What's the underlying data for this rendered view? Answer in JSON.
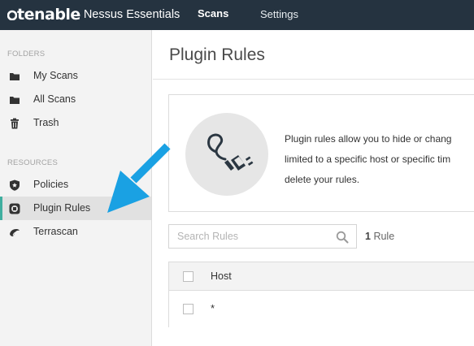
{
  "topbar": {
    "logo_text": "tenable",
    "product": "Nessus Essentials",
    "nav": [
      {
        "label": "Scans",
        "active": true
      },
      {
        "label": "Settings",
        "active": false
      }
    ],
    "background": "#253340"
  },
  "sidebar": {
    "folders_label": "FOLDERS",
    "folders": [
      {
        "label": "My Scans",
        "icon": "folder-icon"
      },
      {
        "label": "All Scans",
        "icon": "folder-icon"
      },
      {
        "label": "Trash",
        "icon": "trash-icon"
      }
    ],
    "resources_label": "RESOURCES",
    "resources": [
      {
        "label": "Policies",
        "icon": "shield-icon"
      },
      {
        "label": "Plugin Rules",
        "icon": "plug-icon",
        "active": true
      },
      {
        "label": "Terrascan",
        "icon": "terrascan-icon"
      }
    ],
    "accent": "#3fae9f"
  },
  "main": {
    "title": "Plugin Rules",
    "info": {
      "line1": "Plugin rules allow you to hide or chang",
      "line2": "limited to a specific host or specific tim",
      "line3": "delete your rules.",
      "icon": "plug-icon"
    },
    "search": {
      "placeholder": "Search Rules",
      "icon": "search-icon"
    },
    "rule_count_number": "1",
    "rule_count_label": "Rule",
    "table": {
      "columns": [
        "Host"
      ],
      "rows": [
        [
          "*"
        ]
      ]
    }
  },
  "annotation": {
    "icon": "arrow-icon",
    "color": "#1aa1e3"
  }
}
